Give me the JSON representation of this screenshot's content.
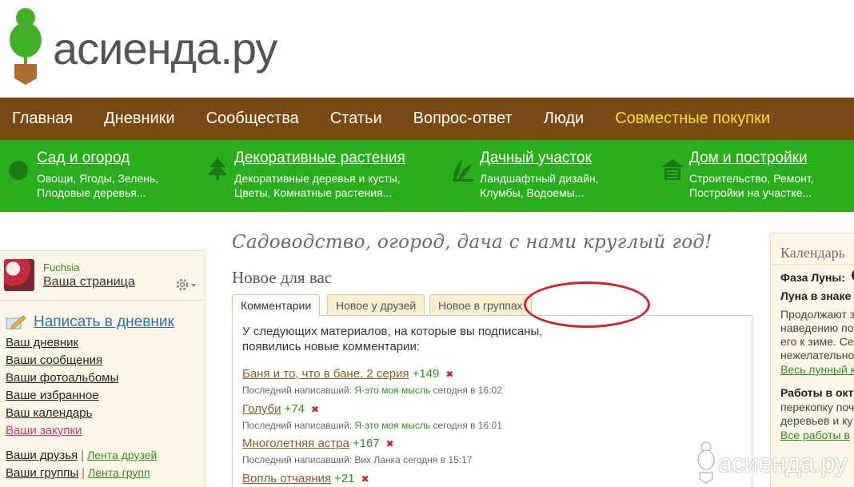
{
  "brand": {
    "logo_text": "асиенда.ру"
  },
  "main_nav": [
    "Главная",
    "Дневники",
    "Сообщества",
    "Статьи",
    "Вопрос-ответ",
    "Люди",
    "Совместные покупки"
  ],
  "categories": [
    {
      "icon": "tomato-icon",
      "title": "Сад и огород",
      "sub1": "Овощи, Ягоды, Зелень,",
      "sub2": "Плодовые деревья..."
    },
    {
      "icon": "tree-icon",
      "title": "Декоративные растения",
      "sub1": "Декоративные деревья и кусты,",
      "sub2": "Цветы, Комнатные растения..."
    },
    {
      "icon": "leaves-icon",
      "title": "Дачный участок",
      "sub1": "Ландшафтный дизайн,",
      "sub2": "Клумбы, Водоемы..."
    },
    {
      "icon": "house-icon",
      "title": "Дом и постройки",
      "sub1": "Строительство, Ремонт,",
      "sub2": "Постройки на участке..."
    }
  ],
  "user": {
    "name": "Fuchsia",
    "page_link": "Ваша страница"
  },
  "sidebar": {
    "write_link": "Написать в дневник",
    "links": [
      "Ваш дневник",
      "Ваши сообщения",
      "Ваши фотоальбомы",
      "Ваше избранное",
      "Ваш календарь",
      "Ваши закупки"
    ],
    "pairs": [
      {
        "a": "Ваши друзья",
        "sep": "|",
        "b": "Лента друзей"
      },
      {
        "a": "Ваши группы",
        "sep": "|",
        "b": "Лента групп"
      }
    ]
  },
  "main": {
    "slogan": "Садоводство, огород, дача с нами круглый год!",
    "section_title": "Новое для вас",
    "tabs": [
      "Комментарии",
      "Новое у друзей",
      "Новое в группах"
    ],
    "intro": "У следующих материалов, на которые вы подписаны, появились новые комментарии:",
    "items": [
      {
        "title": "Баня и то, что в бане. 2 серия",
        "count": "+149",
        "meta_prefix": "Последний написавший:",
        "author": "Я-это моя мысль",
        "time": "сегодня в 16:02"
      },
      {
        "title": "Голуби",
        "count": "+74",
        "meta_prefix": "Последний написавший:",
        "author": "Я-это моя мысль",
        "time": "сегодня в 16:01"
      },
      {
        "title": "Многолетняя астра",
        "count": "+167",
        "meta_prefix": "Последний написавший:",
        "author": "Вих Ланка",
        "time": "сегодня в 15:17"
      },
      {
        "title": "Вопль отчаяния",
        "count": "+21",
        "meta_prefix": "",
        "author": "",
        "time": ""
      }
    ]
  },
  "right": {
    "title": "Календарь",
    "moon_phase_label": "Фаза Луны:",
    "moon_sign_label": "Луна в знаке",
    "text_lines": [
      "Продолжают з",
      "наведению по",
      "его к зиме. Се",
      "нежелательно"
    ],
    "link1": "Весь лунный к",
    "works_title": "Работы в окт",
    "works_lines": [
      "перекопку поч",
      "деревьев и ку"
    ],
    "link2": "Все работы в"
  },
  "watermark": "асиенда.ру",
  "colors": {
    "nav_bg": "#7a4a14",
    "cat_bg": "#2aae1e",
    "accent_yellow": "#f4e224",
    "link_green": "#2f8c1f",
    "link_blue": "#2a73b3"
  }
}
